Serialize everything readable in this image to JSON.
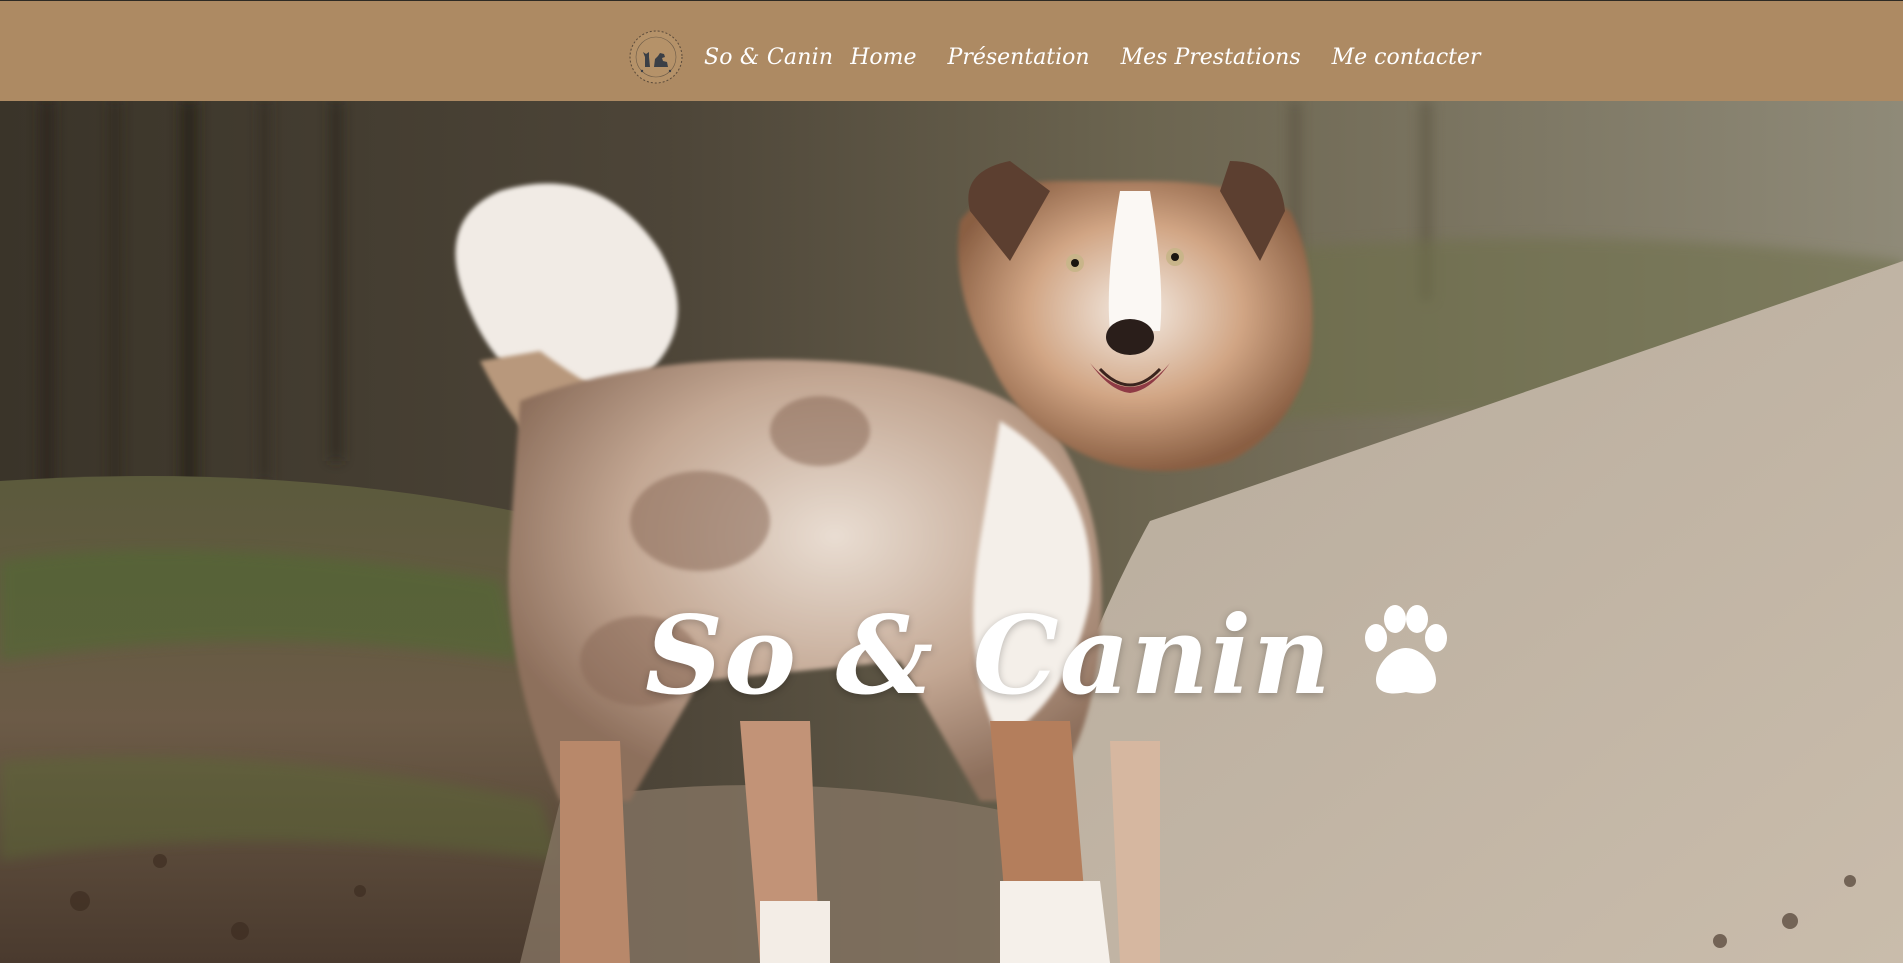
{
  "header": {
    "brand": "So & Canin",
    "logo_icon": "dog-cat-logo-icon",
    "nav": [
      {
        "label": "Home"
      },
      {
        "label": "Présentation"
      },
      {
        "label": "Mes Prestations"
      },
      {
        "label": "Me contacter"
      }
    ]
  },
  "hero": {
    "title": "So & Canin",
    "title_icon": "paw-icon",
    "image": "australian-shepherd-dog-photo"
  },
  "colors": {
    "header_bg": "#ad8a63",
    "text": "#ffffff"
  }
}
